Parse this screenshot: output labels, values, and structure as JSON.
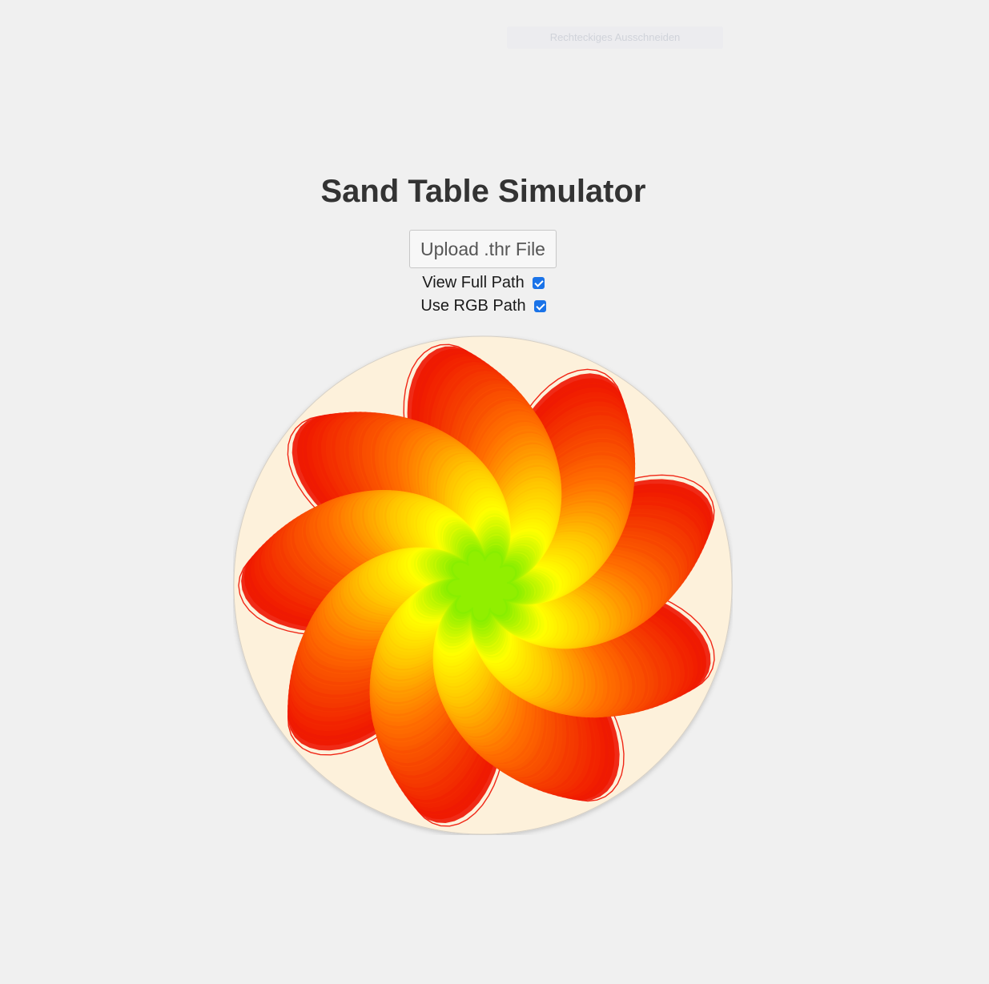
{
  "overlay": {
    "snip_hint": "Rechteckiges Ausschneiden"
  },
  "app": {
    "title": "Sand Table Simulator",
    "upload_button_label": "Upload .thr File",
    "options": [
      {
        "label": "View Full Path",
        "checked": true
      },
      {
        "label": "Use RGB Path",
        "checked": true
      }
    ]
  },
  "canvas": {
    "background_color": "#fdf1db",
    "border_color": "#d6d0c6",
    "path_colors": {
      "outer": "#ee1100",
      "inner": "#88ee00"
    }
  }
}
